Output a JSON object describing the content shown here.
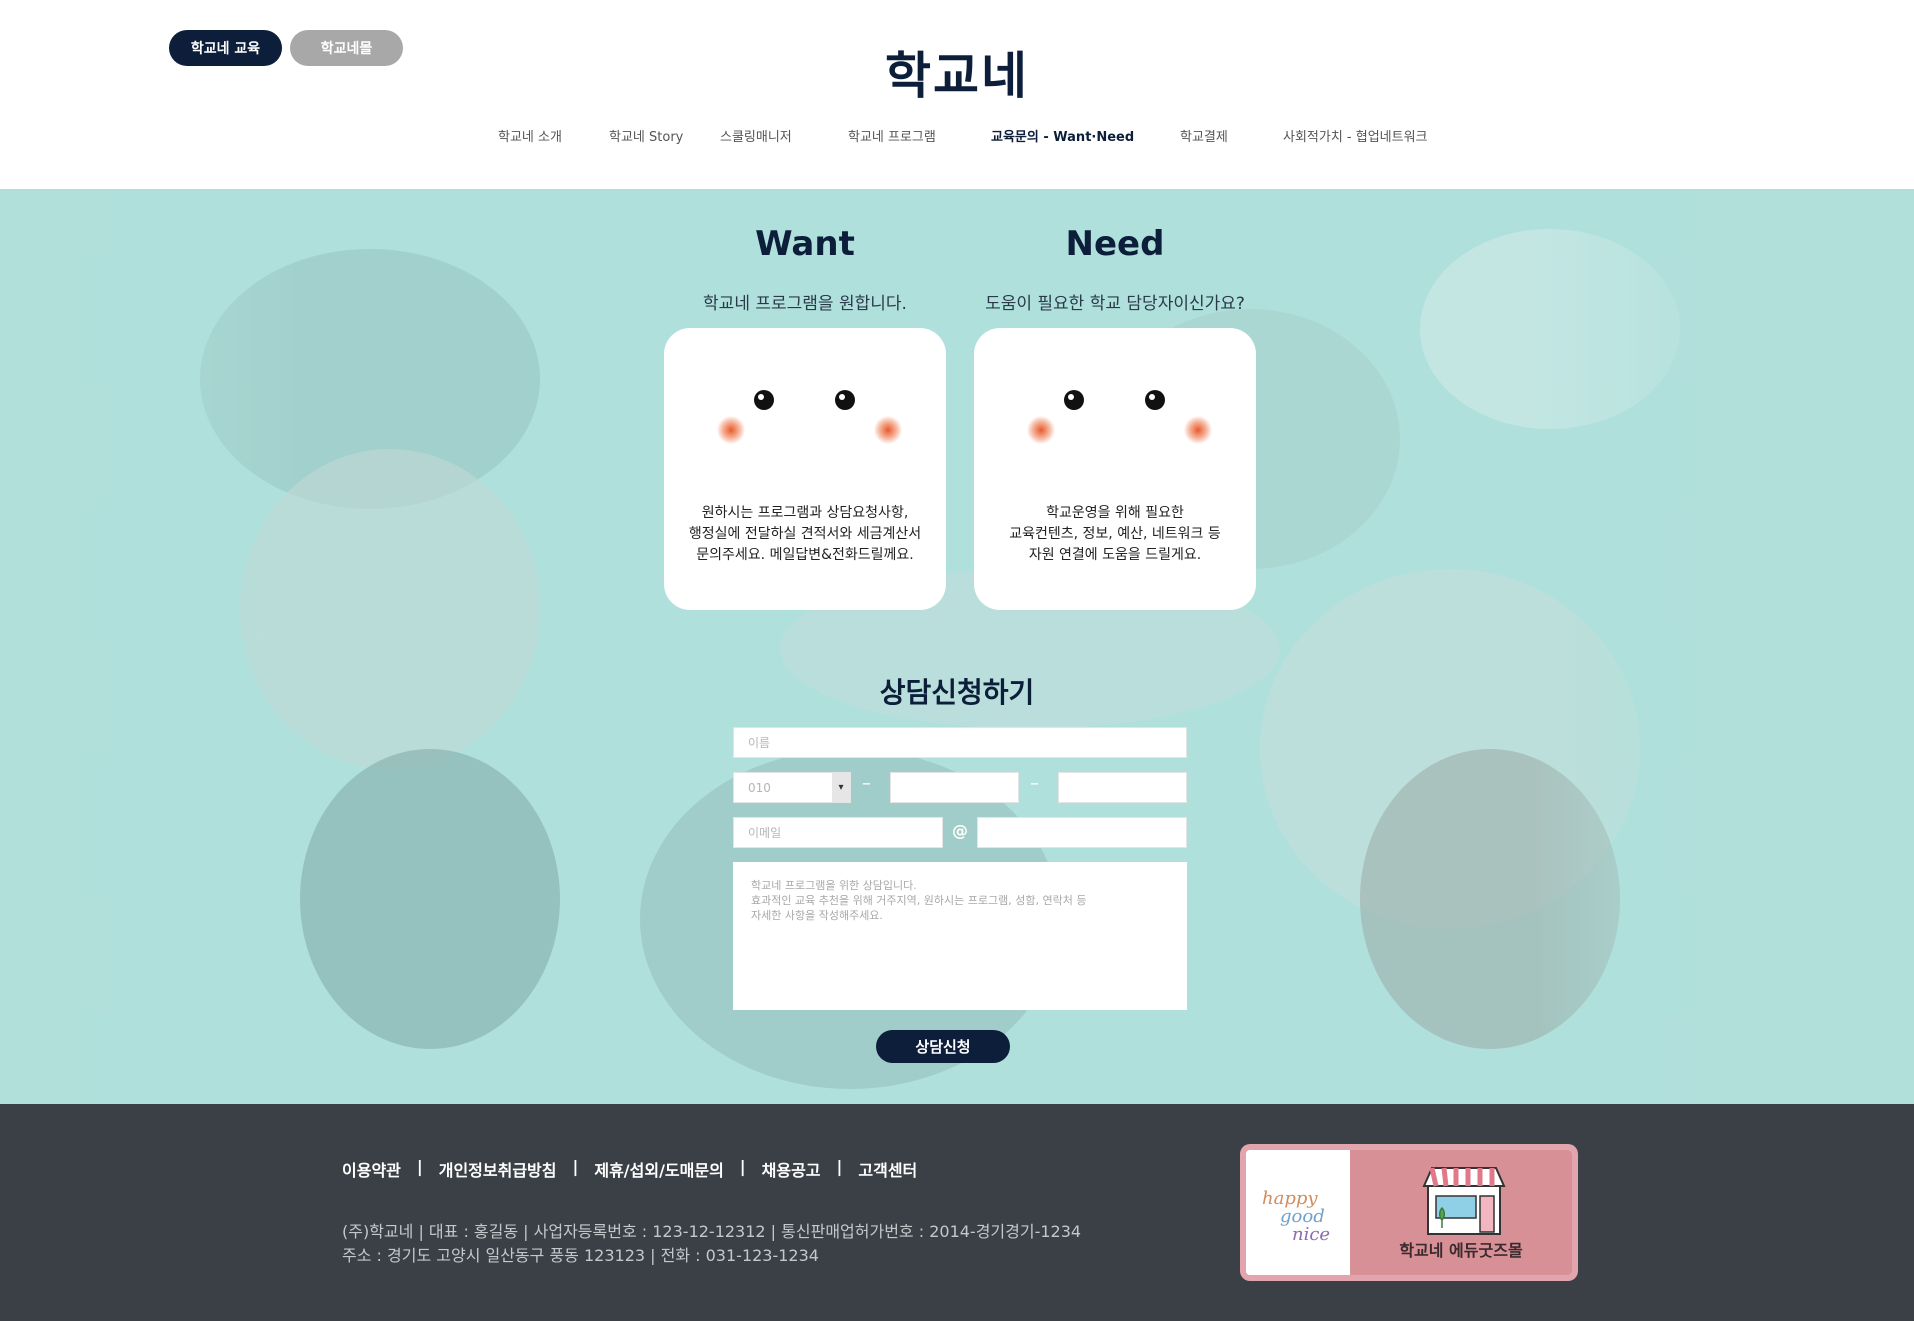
{
  "header": {
    "pill_edu": "학교네 교육",
    "pill_mall": "학교네몰",
    "logo": "학교네",
    "nav": [
      {
        "label": "학교네 소개"
      },
      {
        "label": "학교네 Story"
      },
      {
        "label": "스쿨링매니저"
      },
      {
        "label": "학교네 프로그램"
      },
      {
        "label": "교육문의 - Want·Need",
        "active": true
      },
      {
        "label": "학교결제"
      },
      {
        "label": "사회적가치 - 협업네트워크"
      }
    ]
  },
  "want": {
    "title": "Want",
    "subtitle": "학교네 프로그램을 원합니다.",
    "lines": [
      "원하시는 프로그램과 상담요청사항,",
      "행정실에 전달하실 견적서와 세금계산서",
      "문의주세요. 메일답변&전화드릴께요."
    ]
  },
  "need": {
    "title": "Need",
    "subtitle": "도움이 필요한 학교 담당자이신가요?",
    "lines": [
      "학교운영을 위해 필요한",
      "교육컨텐츠, 정보, 예산, 네트워크 등",
      "자원 연결에 도움을 드릴게요."
    ]
  },
  "form": {
    "title": "상담신청하기",
    "name_placeholder": "이름",
    "phone_prefix": "010",
    "phone_dash": "–",
    "email_placeholder": "이메일",
    "email_at": "@",
    "message_lines": [
      "학교네 프로그램을 위한 상담입니다.",
      "효과적인 교육 추천을 위해 거주지역, 원하시는 프로그램, 성함, 연락처 등",
      "자세한 사항을 작성해주세요."
    ],
    "submit": "상담신청"
  },
  "footer": {
    "links": [
      "이용약관",
      "개인정보취급방침",
      "제휴/섭외/도매문의",
      "채용공고",
      "고객센터"
    ],
    "separator": "|",
    "info_line1": "(주)학교네   |   대표 : 홍길동   |   사업자등록번호 : 123-12-12312   |   통신판매업허가번호 : 2014-경기경기-1234",
    "info_line2": "주소 : 경기도 고양시 일산동구 풍동 123123   |   전화 : 031-123-1234",
    "banner_brand": [
      "happy",
      "good",
      "nice"
    ],
    "banner_label": "학교네 에듀굿즈몰"
  },
  "colors": {
    "navy": "#0c1e3a",
    "mint": "#b0e0dc",
    "footer_bg": "#3a4046",
    "banner_pink": "#e2a5ad"
  }
}
